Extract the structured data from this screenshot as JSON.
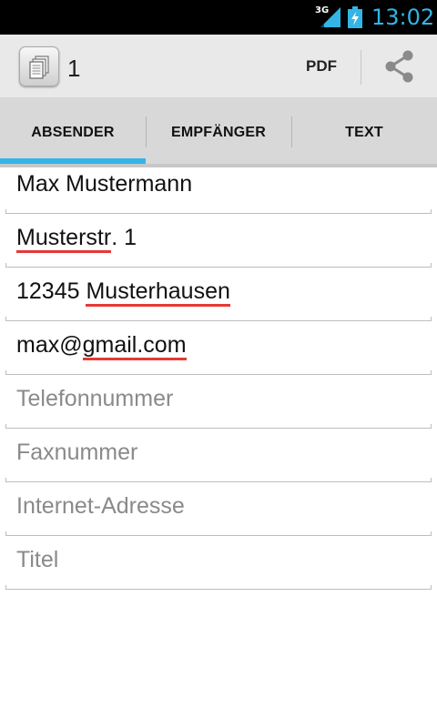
{
  "status_bar": {
    "network": "3G",
    "time": "13:02",
    "accent_color": "#33b5e5",
    "icons": [
      "signal-icon",
      "battery-charging-icon"
    ]
  },
  "action_bar": {
    "icon": "documents-icon",
    "title": "1",
    "pdf_label": "PDF",
    "share_icon": "share-icon"
  },
  "tabs": [
    {
      "label": "ABSENDER",
      "selected": true
    },
    {
      "label": "EMPFÄNGER",
      "selected": false
    },
    {
      "label": "TEXT",
      "selected": false
    }
  ],
  "form": {
    "name": {
      "value": "Max Mustermann"
    },
    "street": {
      "value_a": "Musterstr",
      "value_b": ". 1"
    },
    "city": {
      "value_a": "12345 ",
      "value_b": "Musterhausen"
    },
    "email": {
      "value_a": "max@",
      "value_b": "gmail.com"
    },
    "phone": {
      "placeholder": "Telefonnummer"
    },
    "fax": {
      "placeholder": "Faxnummer"
    },
    "website": {
      "placeholder": "Internet-Adresse"
    },
    "title": {
      "placeholder": "Titel"
    }
  }
}
